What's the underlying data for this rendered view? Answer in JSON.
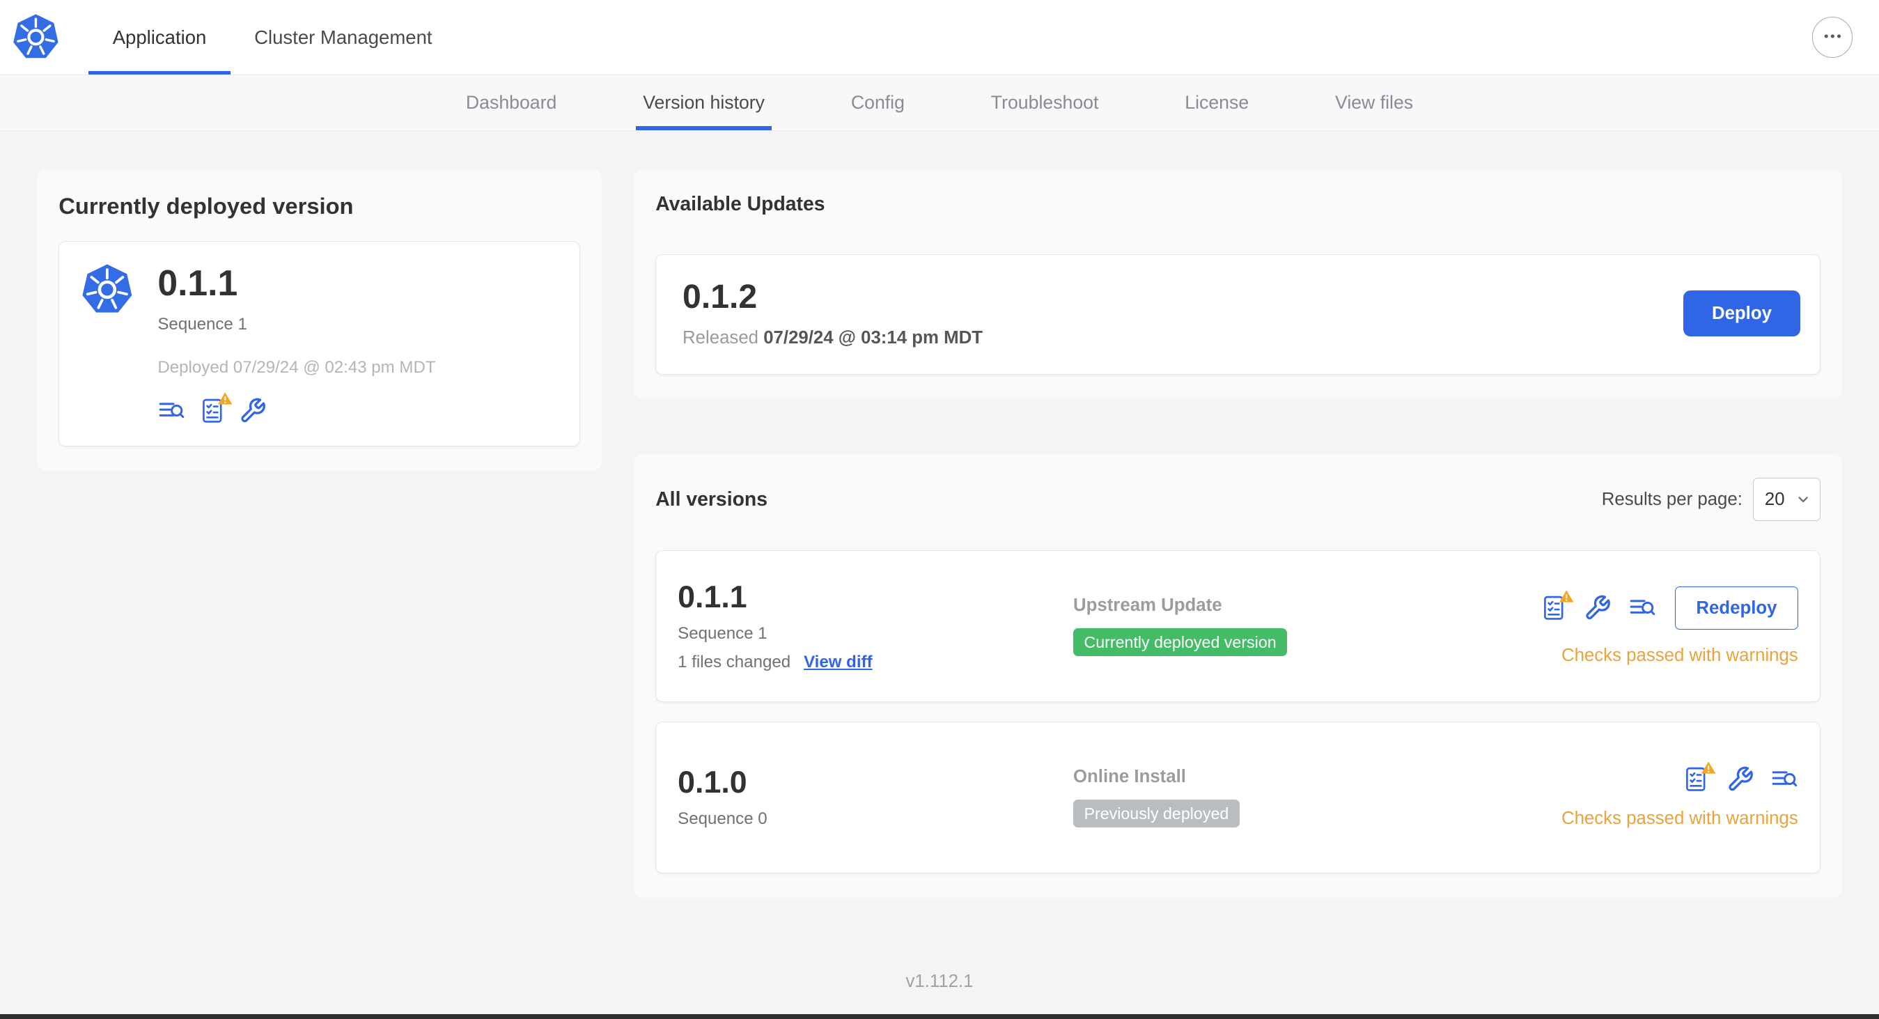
{
  "colors": {
    "accent": "#3066E5",
    "k8s_blue": "#326DE6",
    "green_badge": "#44BB66",
    "gray_badge": "#B9BDC0",
    "warning": "#E8A33D"
  },
  "icons": {
    "ellipsis": "•••",
    "kubernetes_logo": "blue heptagon with white ship wheel",
    "logs": "lines with magnifier",
    "preflight_checks": "checklist",
    "warning_triangle": "orange triangle with exclamation",
    "config_wrench": "wrench",
    "chevron_down": "chevron"
  },
  "header": {
    "tabs": [
      {
        "label": "Application",
        "active": true
      },
      {
        "label": "Cluster Management",
        "active": false
      }
    ]
  },
  "subnav": {
    "tabs": [
      "Dashboard",
      "Version history",
      "Config",
      "Troubleshoot",
      "License",
      "View files"
    ],
    "active": "Version history"
  },
  "current_version": {
    "title": "Currently deployed version",
    "version": "0.1.1",
    "sequence": "Sequence 1",
    "deployed": "Deployed 07/29/24 @ 02:43 pm MDT"
  },
  "available_updates": {
    "title": "Available Updates",
    "version": "0.1.2",
    "released_prefix": "Released",
    "released_date": "07/29/24 @ 03:14 pm MDT",
    "deploy_label": "Deploy"
  },
  "all_versions": {
    "title": "All versions",
    "results_per_page_label": "Results per page:",
    "results_per_page_value": "20",
    "rows": [
      {
        "version": "0.1.1",
        "sequence": "Sequence 1",
        "files_changed": "1 files changed",
        "view_diff": "View diff",
        "source": "Upstream Update",
        "badge": "Currently deployed version",
        "badge_type": "green",
        "status": "Checks passed with warnings",
        "action": "Redeploy"
      },
      {
        "version": "0.1.0",
        "sequence": "Sequence 0",
        "source": "Online Install",
        "badge": "Previously deployed",
        "badge_type": "gray",
        "status": "Checks passed with warnings"
      }
    ]
  },
  "footer": {
    "version": "v1.112.1"
  }
}
